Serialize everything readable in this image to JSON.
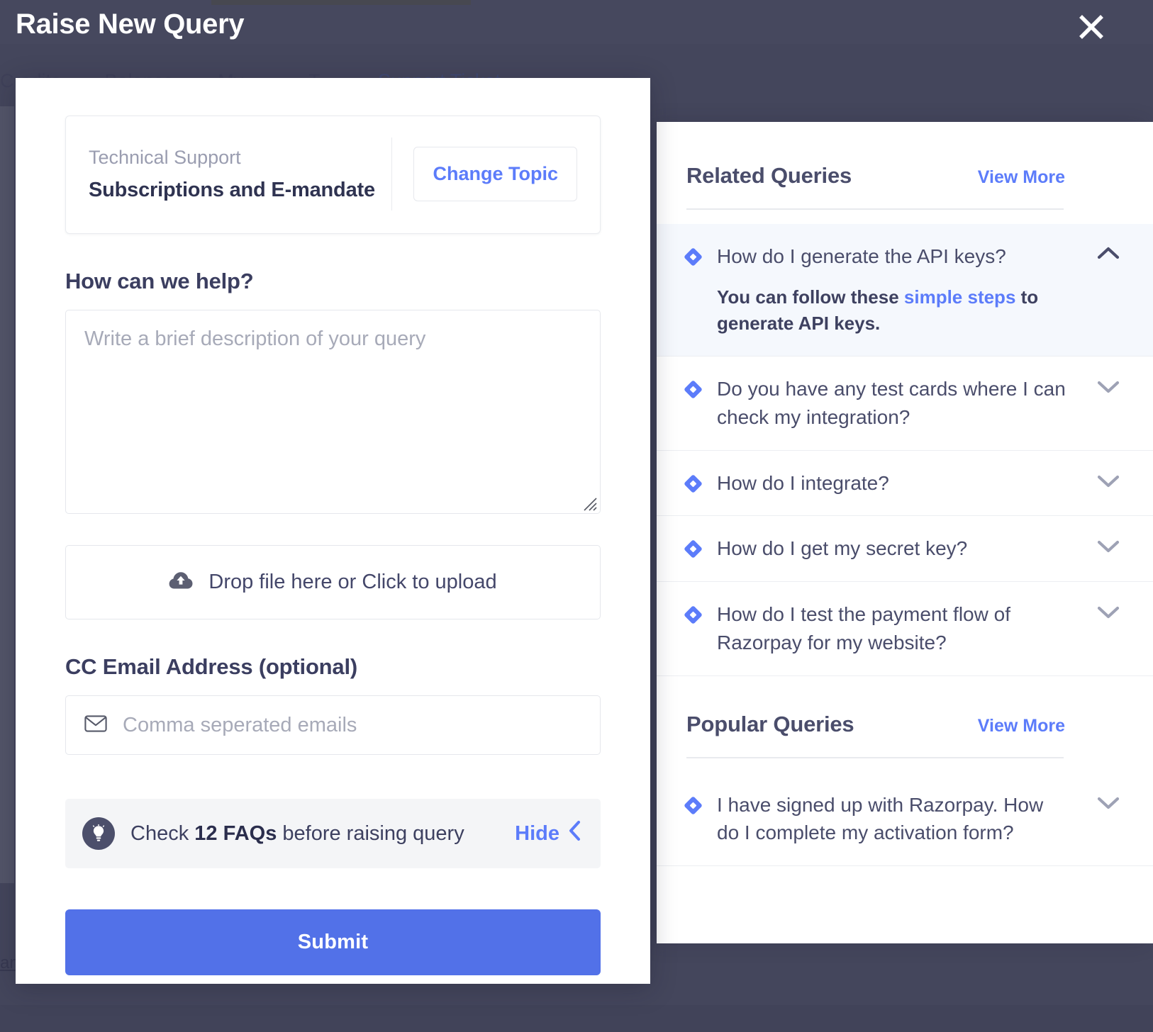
{
  "modal": {
    "title": "Raise New Query",
    "close_icon": "close-icon"
  },
  "background": {
    "tabs": [
      "Credits",
      "Balance",
      "My ...",
      "T...",
      "Support Ticket"
    ],
    "footer_link": "an"
  },
  "topic": {
    "category": "Technical Support",
    "name": "Subscriptions and E-mandate",
    "change_button": "Change Topic"
  },
  "form": {
    "help_label": "How can we help?",
    "description_placeholder": "Write a brief description of your query",
    "description_value": "",
    "upload_label": "Drop file here or Click to upload",
    "upload_icon": "cloud-upload-icon",
    "cc_label": "CC Email Address (optional)",
    "cc_placeholder": "Comma seperated emails",
    "cc_value": "",
    "cc_icon": "envelope-icon",
    "faq_icon": "lightbulb-icon",
    "faq_prefix": "Check ",
    "faq_count": "12 FAQs",
    "faq_suffix": " before raising query",
    "faq_hide_label": "Hide",
    "faq_hide_icon": "chevron-left-icon",
    "submit_label": "Submit"
  },
  "related": {
    "title": "Related Queries",
    "view_more": "View More",
    "items": [
      {
        "question": "How do I generate the API keys?",
        "expanded": true,
        "chevron": "chevron-up-icon",
        "answer_before": "You can follow these ",
        "answer_link": "simple steps",
        "answer_after": " to generate API keys."
      },
      {
        "question": "Do you have any test cards where I can check my integration?",
        "expanded": false,
        "chevron": "chevron-down-icon"
      },
      {
        "question": "How do I integrate?",
        "expanded": false,
        "chevron": "chevron-down-icon"
      },
      {
        "question": "How do I get my secret key?",
        "expanded": false,
        "chevron": "chevron-down-icon"
      },
      {
        "question": "How do I test the payment flow of Razorpay for my website?",
        "expanded": false,
        "chevron": "chevron-down-icon"
      }
    ]
  },
  "popular": {
    "title": "Popular Queries",
    "view_more": "View More",
    "items": [
      {
        "question": "I have signed up with Razorpay. How do I complete my activation form?",
        "expanded": false,
        "chevron": "chevron-down-icon"
      }
    ]
  },
  "colors": {
    "accent_blue": "#5c7cfa",
    "submit_blue": "#5271e8",
    "scrim": "#52546a",
    "heading": "#4a4d6b"
  }
}
